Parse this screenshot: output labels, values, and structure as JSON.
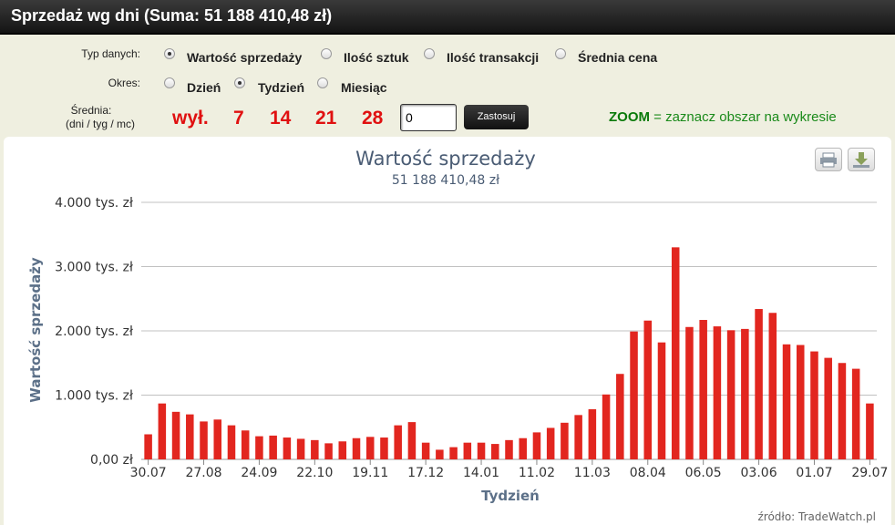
{
  "header": {
    "title": "Sprzedaż wg dni (Suma: 51 188 410,48 zł)"
  },
  "controls": {
    "data_type_label": "Typ danych:",
    "data_type_options": [
      {
        "label": "Wartość sprzedaży",
        "selected": true
      },
      {
        "label": "Ilość sztuk",
        "selected": false
      },
      {
        "label": "Ilość transakcji",
        "selected": false
      },
      {
        "label": "Średnia cena",
        "selected": false
      }
    ],
    "period_label": "Okres:",
    "period_options": [
      {
        "label": "Dzień",
        "selected": false
      },
      {
        "label": "Tydzień",
        "selected": true
      },
      {
        "label": "Miesiąc",
        "selected": false
      }
    ],
    "average_label_1": "Średnia:",
    "average_label_2": "(dni / tyg / mc)",
    "average_options": [
      "wył.",
      "7",
      "14",
      "21",
      "28"
    ],
    "average_input_value": "0",
    "apply_label": "Zastosuj",
    "zoom_keyword": "ZOOM",
    "zoom_text": " = zaznacz obszar na wykresie"
  },
  "icons": {
    "print": "printer-icon",
    "download": "download-icon"
  },
  "colors": {
    "bar": "#e2261f",
    "grid": "#c0c0c0",
    "title": "#4a5c74",
    "axis_title": "#5c7088",
    "zoom": "#1a8a1a",
    "average": "#e01010"
  },
  "chart_data": {
    "type": "bar",
    "title": "Wartość sprzedaży",
    "subtitle": "51 188 410,48 zł",
    "xlabel": "Tydzień",
    "ylabel": "Wartość sprzedaży",
    "ylim": [
      0,
      4000
    ],
    "y_ticks": [
      0,
      1000,
      2000,
      3000,
      4000
    ],
    "y_tick_labels": [
      "0,00 zł",
      "1.000 tys. zł",
      "2.000 tys. zł",
      "3.000 tys. zł",
      "4.000 tys. zł"
    ],
    "x_tick_labels": [
      "30.07",
      "27.08",
      "24.09",
      "22.10",
      "19.11",
      "17.12",
      "14.01",
      "11.02",
      "11.03",
      "08.04",
      "06.05",
      "03.06",
      "01.07",
      "29.07"
    ],
    "grid": true,
    "legend": false,
    "source": "źródło: TradeWatch.pl",
    "series": [
      {
        "values": [
          390,
          870,
          740,
          700,
          590,
          620,
          530,
          450,
          360,
          370,
          340,
          320,
          300,
          250,
          280,
          330,
          350,
          340,
          530,
          580,
          260,
          150,
          190,
          260,
          260,
          240,
          300,
          330,
          420,
          490,
          570,
          690,
          780,
          1010,
          1330,
          1990,
          2160,
          1820,
          3300,
          2060,
          2170,
          2070,
          2010,
          2030,
          2340,
          2280,
          1790,
          1780,
          1680,
          1580,
          1500,
          1410,
          870
        ]
      }
    ]
  },
  "footer": {
    "source": "źródło: TradeWatch.pl"
  }
}
